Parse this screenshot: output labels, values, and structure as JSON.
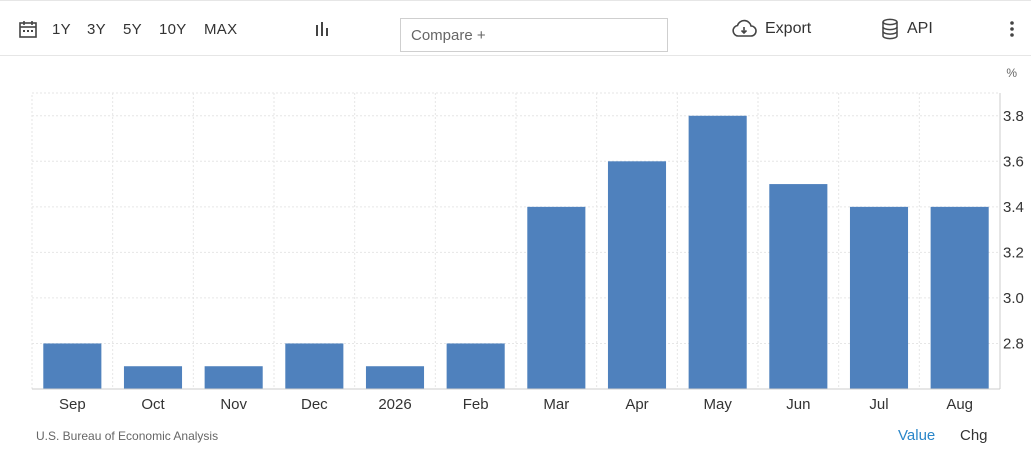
{
  "toolbar": {
    "ranges": [
      "1Y",
      "3Y",
      "5Y",
      "10Y",
      "MAX"
    ],
    "compare_placeholder": "Compare +",
    "export_label": "Export",
    "api_label": "API"
  },
  "chart_data": {
    "type": "bar",
    "categories": [
      "Sep",
      "Oct",
      "Nov",
      "Dec",
      "2026",
      "Feb",
      "Mar",
      "Apr",
      "May",
      "Jun",
      "Jul",
      "Aug"
    ],
    "values": [
      2.8,
      2.7,
      2.7,
      2.8,
      2.7,
      2.8,
      3.4,
      3.6,
      3.8,
      3.5,
      3.4,
      3.4
    ],
    "unit": "%",
    "ylim": [
      2.6,
      3.9
    ],
    "yticks": [
      2.8,
      3.0,
      3.2,
      3.4,
      3.6,
      3.8
    ],
    "ytick_labels": [
      "2.8",
      "3.0",
      "3.2",
      "3.4",
      "3.6",
      "3.8"
    ],
    "y_axis_side": "right",
    "grid": true,
    "bar_color": "#4f81bd"
  },
  "footer": {
    "source": "U.S. Bureau of Economic Analysis",
    "value_label": "Value",
    "chg_label": "Chg",
    "value_color": "#2a86c9"
  }
}
